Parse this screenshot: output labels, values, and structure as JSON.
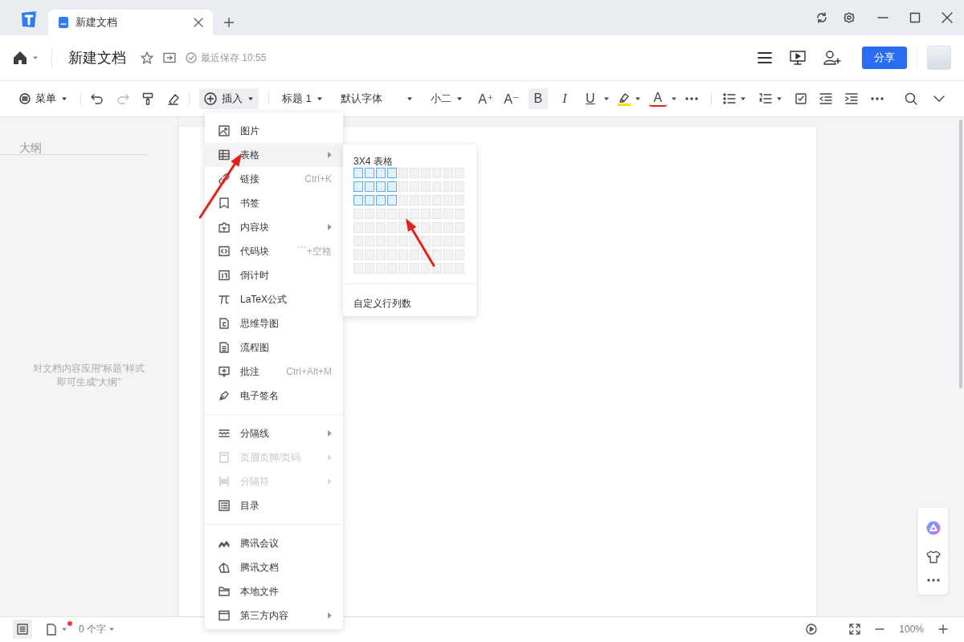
{
  "tab": {
    "title": "新建文档"
  },
  "document": {
    "title": "新建文档",
    "save_status": "最近保存 10:55"
  },
  "share_button": "分享",
  "toolbar": {
    "menu": "菜单",
    "insert": {
      "label": "插入",
      "open": true
    },
    "heading": "标题 1",
    "font": "默认字体",
    "size": "小二",
    "font_increase": "A⁺",
    "font_decrease": "A⁻",
    "bold": {
      "label": "B",
      "active": true
    },
    "italic": "I",
    "underline": "U",
    "font_color": "A"
  },
  "outline": {
    "title": "大纲",
    "hint": [
      "对文档内容应用“标题”样式",
      "即可生成“大纲”"
    ]
  },
  "insert_menu": {
    "groups": [
      [
        {
          "label": "图片",
          "submenu": false,
          "disabled": false,
          "selected": false
        },
        {
          "label": "表格",
          "submenu": true,
          "disabled": false,
          "selected": true
        },
        {
          "label": "链接",
          "shortcut": "Ctrl+K",
          "submenu": false,
          "disabled": false,
          "selected": false
        },
        {
          "label": "书签",
          "submenu": false,
          "disabled": false,
          "selected": false
        },
        {
          "label": "内容块",
          "submenu": true,
          "disabled": false,
          "selected": false
        },
        {
          "label": "代码块",
          "shortcut": "```+空格",
          "submenu": false,
          "disabled": false,
          "selected": false
        },
        {
          "label": "倒计时",
          "submenu": false,
          "disabled": false,
          "selected": false
        },
        {
          "label": "LaTeX公式",
          "submenu": false,
          "disabled": false,
          "selected": false
        },
        {
          "label": "思维导图",
          "submenu": false,
          "disabled": false,
          "selected": false
        },
        {
          "label": "流程图",
          "submenu": false,
          "disabled": false,
          "selected": false
        },
        {
          "label": "批注",
          "shortcut": "Ctrl+Alt+M",
          "submenu": false,
          "disabled": false,
          "selected": false
        },
        {
          "label": "电子签名",
          "submenu": false,
          "disabled": false,
          "selected": false
        }
      ],
      [
        {
          "label": "分隔线",
          "submenu": true,
          "disabled": false,
          "selected": false
        },
        {
          "label": "页眉页脚/页码",
          "submenu": true,
          "disabled": true,
          "selected": false
        },
        {
          "label": "分隔符",
          "submenu": true,
          "disabled": true,
          "selected": false
        },
        {
          "label": "目录",
          "submenu": false,
          "disabled": false,
          "selected": false
        }
      ],
      [
        {
          "label": "腾讯会议",
          "submenu": false,
          "disabled": false,
          "selected": false
        },
        {
          "label": "腾讯文档",
          "submenu": false,
          "disabled": false,
          "selected": false
        },
        {
          "label": "本地文件",
          "submenu": false,
          "disabled": false,
          "selected": false
        },
        {
          "label": "第三方内容",
          "submenu": true,
          "disabled": false,
          "selected": false
        }
      ]
    ]
  },
  "table_submenu": {
    "caption": "3X4 表格",
    "grid": [
      [
        true,
        true,
        true,
        true,
        false,
        false,
        false,
        false,
        false,
        false
      ],
      [
        true,
        true,
        true,
        true,
        false,
        false,
        false,
        false,
        false,
        false
      ],
      [
        true,
        true,
        true,
        true,
        false,
        false,
        false,
        false,
        false,
        false
      ],
      [
        false,
        false,
        false,
        false,
        false,
        false,
        false,
        false,
        false,
        false
      ],
      [
        false,
        false,
        false,
        false,
        false,
        false,
        false,
        false,
        false,
        false
      ],
      [
        false,
        false,
        false,
        false,
        false,
        false,
        false,
        false,
        false,
        false
      ],
      [
        false,
        false,
        false,
        false,
        false,
        false,
        false,
        false,
        false,
        false
      ],
      [
        false,
        false,
        false,
        false,
        false,
        false,
        false,
        false,
        false,
        false
      ]
    ],
    "custom": "自定义行列数"
  },
  "status_bar": {
    "outline_toggle_on": true,
    "word_count": "0 个字",
    "zoom": "100%"
  }
}
